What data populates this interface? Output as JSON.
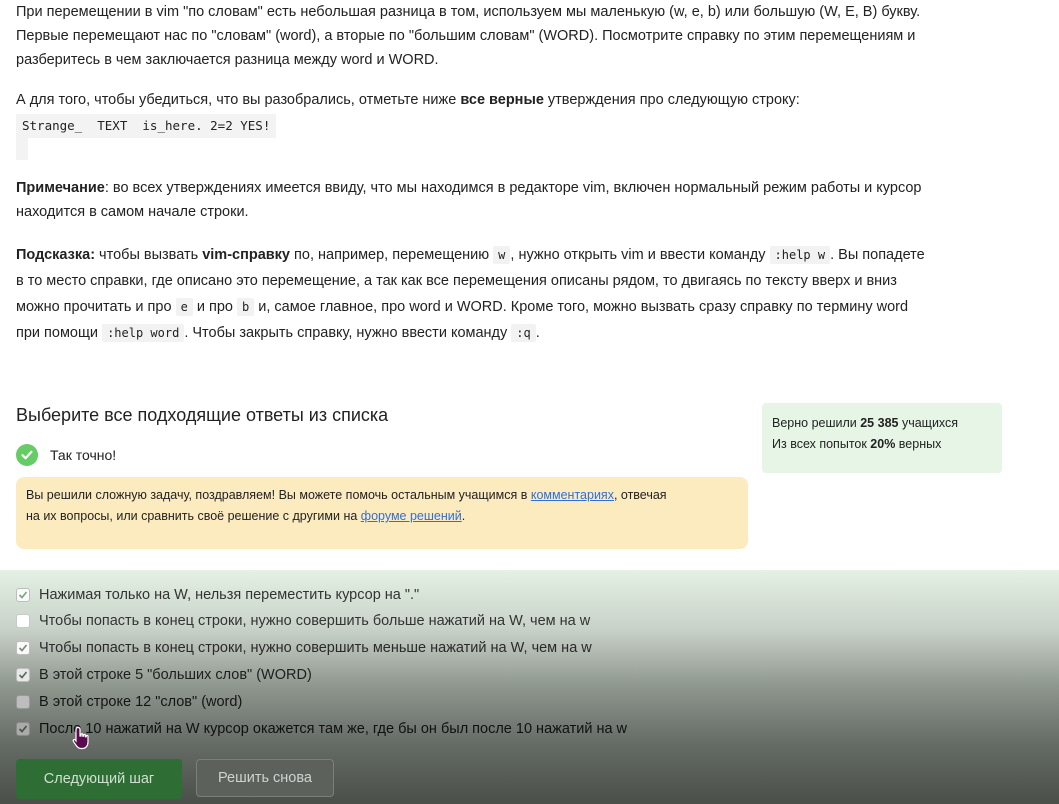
{
  "intro": {
    "line1": "При перемещении в vim \"по словам\" есть небольшая разница в том, используем мы маленькую (w, e, b) или большую (W, E, B) букву.",
    "line2": "Первые перемещают нас по \"словам\" (word), а вторые по \"большим словам\" (WORD). Посмотрите справку по этим перемещениям и",
    "line3": "разберитесь в чем заключается разница между word и WORD."
  },
  "task": {
    "prefix": "А для того, чтобы убедиться, что вы разобрались, отметьте ниже ",
    "bold": "все верные",
    "suffix": " утверждения про следующую строку:",
    "code": "Strange_  TEXT  is_here. 2=2 YES!"
  },
  "note": {
    "label": "Примечание",
    "line1": ": во всех утверждениях имеется ввиду, что мы находимся в редакторе vim, включен нормальный режим работы и курсор",
    "line2": "находится в самом начале строки."
  },
  "hint": {
    "label": "Подсказка:",
    "t1": " чтобы вызвать ",
    "b1": "vim-справку",
    "t2": " по, например, перемещению ",
    "c1": "w",
    "t3": ", нужно открыть vim и ввести команду ",
    "c2": ":help w",
    "t4": ". Вы попадете",
    "line2": "в то место справки, где описано это перемещение, а так как все перемещения описаны рядом, то двигаясь по тексту вверх и вниз",
    "t5": "можно прочитать и про ",
    "c3": "e",
    "t6": " и про ",
    "c4": "b",
    "t7": " и, самое главное, про word и WORD. Кроме того, можно вызвать сразу справку по термину word",
    "t8": "при помощи ",
    "c5": ":help word",
    "t9": ". Чтобы закрыть справку, нужно ввести команду ",
    "c6": ":q",
    "t10": "."
  },
  "quiz": {
    "title": "Выберите все подходящие ответы из списка",
    "correct_label": "Так точно!",
    "notice_t1": "Вы решили сложную задачу, поздравляем! Вы можете помочь остальным учащимся в ",
    "notice_link1": "комментариях",
    "notice_t2": ", отвечая",
    "notice_t3": "на их вопросы, или сравнить своё решение с другими на ",
    "notice_link2": "форуме решений",
    "notice_t4": ".",
    "stats_t1": "Верно решили ",
    "stats_count": "25 385",
    "stats_t2": " учащихся",
    "stats_t3": "Из всех попыток ",
    "stats_pct": "20%",
    "stats_t4": " верных",
    "answers": [
      {
        "label": "Нажимая только на W, нельзя переместить курсор на \".\"",
        "checked": true
      },
      {
        "label": "Чтобы попасть в конец строки, нужно совершить больше нажатий на W, чем на w",
        "checked": false
      },
      {
        "label": "Чтобы попасть в конец строки, нужно совершить меньше нажатий на W, чем на w",
        "checked": true
      },
      {
        "label": "В этой строке 5 \"больших слов\" (WORD)",
        "checked": true
      },
      {
        "label": "В этой строке 12 \"слов\" (word)",
        "checked": false
      },
      {
        "label": "После 10 нажатий на W курсор окажется там же, где бы он был после 10 нажатий на w",
        "checked": true
      }
    ],
    "next_button": "Следующий шаг",
    "retry_button": "Решить снова"
  },
  "colors": {
    "accent_green": "#66cc66",
    "notice_bg": "#fdebc0",
    "stats_bg": "#e6f5e6",
    "link": "#2f6fd8"
  },
  "icons": [
    "check-circle-icon",
    "checkbox-check-icon",
    "hand-pointer-icon"
  ]
}
